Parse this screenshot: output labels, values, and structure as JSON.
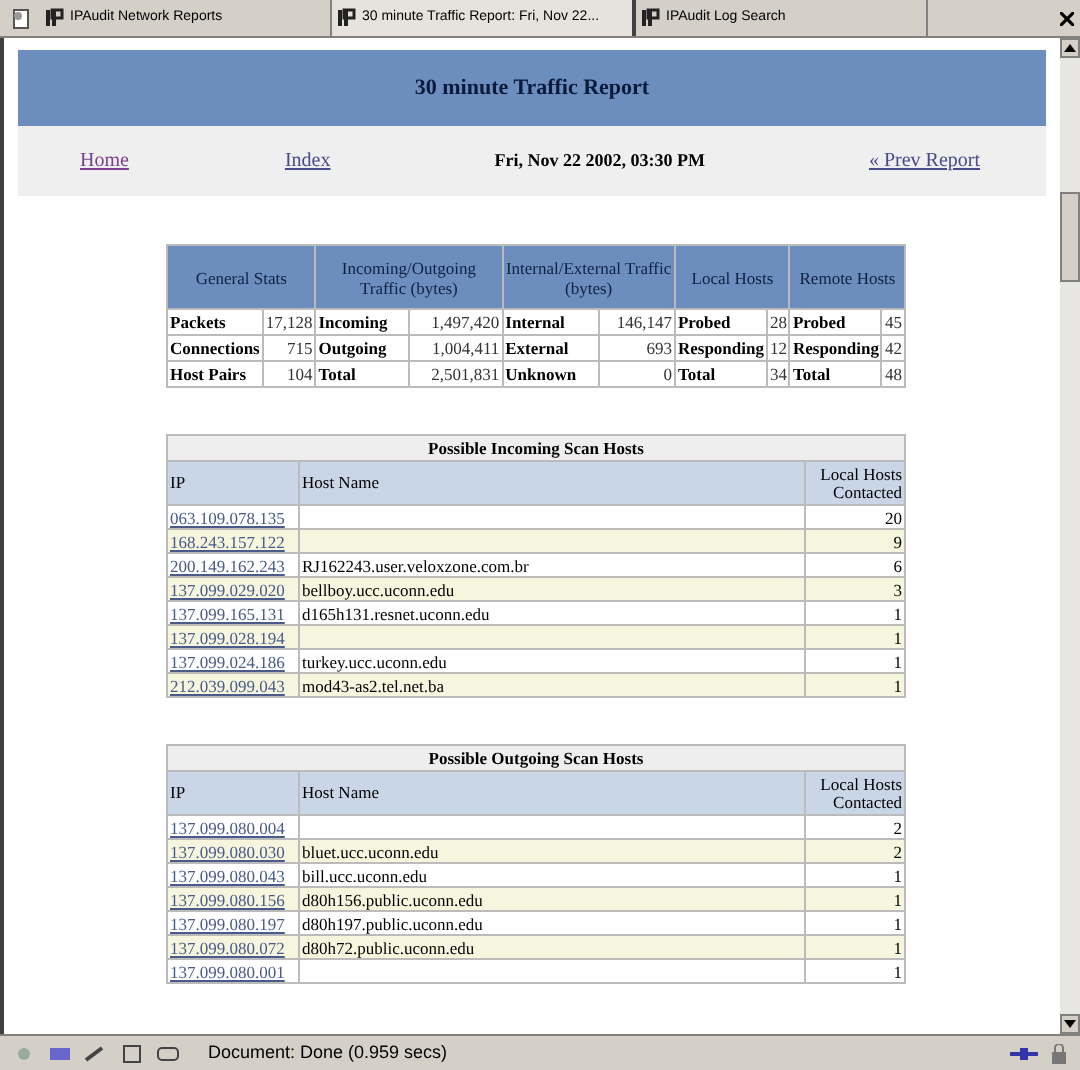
{
  "tabs": [
    {
      "label": "IPAudit Network Reports",
      "selected": false
    },
    {
      "label": "30 minute Traffic Report: Fri, Nov 22...",
      "selected": true
    },
    {
      "label": "IPAudit Log Search",
      "selected": false
    }
  ],
  "header": {
    "title": "30 minute Traffic Report"
  },
  "nav": {
    "links": [
      "Home",
      "Index"
    ],
    "date": "Fri, Nov 22 2002, 03:30 PM",
    "prev": "« Prev Report"
  },
  "stats": {
    "headers": [
      "General Stats",
      "Incoming/Outgoing Traffic (bytes)",
      "Internal/External Traffic (bytes)",
      "Local Hosts",
      "Remote Hosts"
    ],
    "rows": [
      [
        "Packets",
        "17,128",
        "Incoming",
        "1,497,420",
        "Internal",
        "146,147",
        "Probed",
        "28",
        "Probed",
        "45"
      ],
      [
        "Connections",
        "715",
        "Outgoing",
        "1,004,411",
        "External",
        "693",
        "Responding",
        "12",
        "Responding",
        "42"
      ],
      [
        "Host Pairs",
        "104",
        "Total",
        "2,501,831",
        "Unknown",
        "0",
        "Total",
        "34",
        "Total",
        "48"
      ]
    ]
  },
  "scan_tables": [
    {
      "title": "Possible Incoming Scan Hosts",
      "columns": [
        "IP",
        "Host Name",
        "Local Hosts Contacted"
      ],
      "rows": [
        [
          "063.109.078.135",
          "",
          "20"
        ],
        [
          "168.243.157.122",
          "",
          "9"
        ],
        [
          "200.149.162.243",
          "RJ162243.user.veloxzone.com.br",
          "6"
        ],
        [
          "137.099.029.020",
          "bellboy.ucc.uconn.edu",
          "3"
        ],
        [
          "137.099.165.131",
          "d165h131.resnet.uconn.edu",
          "1"
        ],
        [
          "137.099.028.194",
          "",
          "1"
        ],
        [
          "137.099.024.186",
          "turkey.ucc.uconn.edu",
          "1"
        ],
        [
          "212.039.099.043",
          "mod43-as2.tel.net.ba",
          "1"
        ]
      ]
    },
    {
      "title": "Possible Outgoing Scan Hosts",
      "columns": [
        "IP",
        "Host Name",
        "Local Hosts Contacted"
      ],
      "rows": [
        [
          "137.099.080.004",
          "",
          "2"
        ],
        [
          "137.099.080.030",
          "bluet.ucc.uconn.edu",
          "2"
        ],
        [
          "137.099.080.043",
          "bill.ucc.uconn.edu",
          "1"
        ],
        [
          "137.099.080.156",
          "d80h156.public.uconn.edu",
          "1"
        ],
        [
          "137.099.080.197",
          "d80h197.public.uconn.edu",
          "1"
        ],
        [
          "137.099.080.072",
          "d80h72.public.uconn.edu",
          "1"
        ],
        [
          "137.099.080.001",
          "",
          "1"
        ]
      ]
    }
  ],
  "status_bar": {
    "text": "Document: Done (0.959 secs)"
  }
}
